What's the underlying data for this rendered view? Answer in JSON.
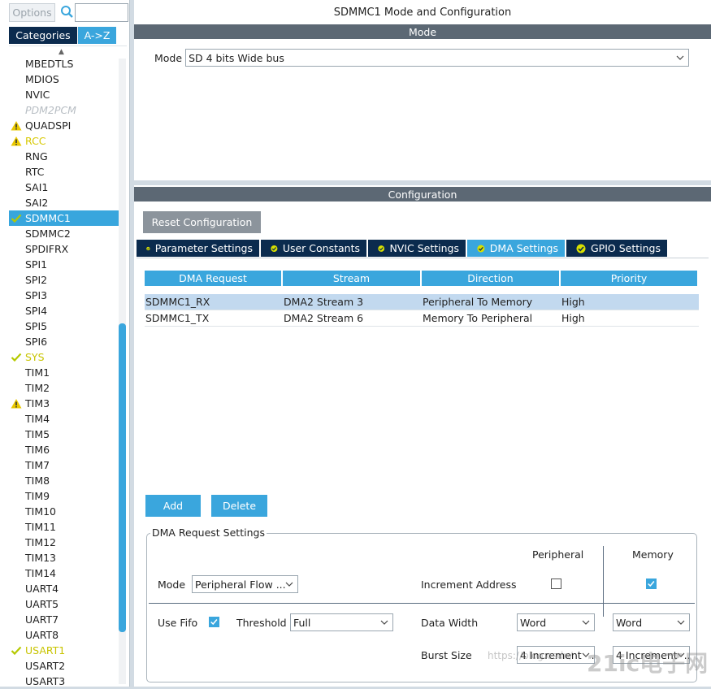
{
  "left": {
    "options_label": "Options",
    "search_placeholder": "",
    "tab_categories": "Categories",
    "tab_az": "A->Z",
    "items": [
      {
        "label": "MBEDTLS",
        "state": "normal"
      },
      {
        "label": "MDIOS",
        "state": "normal"
      },
      {
        "label": "NVIC",
        "state": "normal"
      },
      {
        "label": "PDM2PCM",
        "state": "disabled"
      },
      {
        "label": "QUADSPI",
        "state": "warning"
      },
      {
        "label": "RCC",
        "state": "warning-yellow"
      },
      {
        "label": "RNG",
        "state": "normal"
      },
      {
        "label": "RTC",
        "state": "normal"
      },
      {
        "label": "SAI1",
        "state": "normal"
      },
      {
        "label": "SAI2",
        "state": "normal"
      },
      {
        "label": "SDMMC1",
        "state": "selected-ok"
      },
      {
        "label": "SDMMC2",
        "state": "normal"
      },
      {
        "label": "SPDIFRX",
        "state": "normal"
      },
      {
        "label": "SPI1",
        "state": "normal"
      },
      {
        "label": "SPI2",
        "state": "normal"
      },
      {
        "label": "SPI3",
        "state": "normal"
      },
      {
        "label": "SPI4",
        "state": "normal"
      },
      {
        "label": "SPI5",
        "state": "normal"
      },
      {
        "label": "SPI6",
        "state": "normal"
      },
      {
        "label": "SYS",
        "state": "ok-yellow"
      },
      {
        "label": "TIM1",
        "state": "normal"
      },
      {
        "label": "TIM2",
        "state": "normal"
      },
      {
        "label": "TIM3",
        "state": "warning"
      },
      {
        "label": "TIM4",
        "state": "normal"
      },
      {
        "label": "TIM5",
        "state": "normal"
      },
      {
        "label": "TIM6",
        "state": "normal"
      },
      {
        "label": "TIM7",
        "state": "normal"
      },
      {
        "label": "TIM8",
        "state": "normal"
      },
      {
        "label": "TIM9",
        "state": "normal"
      },
      {
        "label": "TIM10",
        "state": "normal"
      },
      {
        "label": "TIM11",
        "state": "normal"
      },
      {
        "label": "TIM12",
        "state": "normal"
      },
      {
        "label": "TIM13",
        "state": "normal"
      },
      {
        "label": "TIM14",
        "state": "normal"
      },
      {
        "label": "UART4",
        "state": "normal"
      },
      {
        "label": "UART5",
        "state": "normal"
      },
      {
        "label": "UART7",
        "state": "normal"
      },
      {
        "label": "UART8",
        "state": "normal"
      },
      {
        "label": "USART1",
        "state": "ok-yellow"
      },
      {
        "label": "USART2",
        "state": "normal"
      },
      {
        "label": "USART3",
        "state": "normal"
      }
    ]
  },
  "mode_panel": {
    "title": "SDMMC1 Mode and Configuration",
    "section": "Mode",
    "mode_label": "Mode",
    "mode_value": "SD 4 bits Wide bus"
  },
  "config_panel": {
    "section": "Configuration",
    "reset_label": "Reset Configuration",
    "tabs": [
      {
        "label": "Parameter Settings",
        "active": false
      },
      {
        "label": "User Constants",
        "active": false
      },
      {
        "label": "NVIC Settings",
        "active": false
      },
      {
        "label": "DMA Settings",
        "active": true
      },
      {
        "label": "GPIO Settings",
        "active": false
      }
    ],
    "table": {
      "headers": [
        "DMA Request",
        "Stream",
        "Direction",
        "Priority"
      ],
      "rows": [
        [
          "SDMMC1_RX",
          "DMA2 Stream 3",
          "Peripheral To Memory",
          "High"
        ],
        [
          "SDMMC1_TX",
          "DMA2 Stream 6",
          "Memory To Peripheral",
          "High"
        ]
      ]
    },
    "add_label": "Add",
    "delete_label": "Delete",
    "request_settings": {
      "legend": "DMA Request Settings",
      "col_peripheral": "Peripheral",
      "col_memory": "Memory",
      "mode_label": "Mode",
      "mode_value": "Peripheral Flow ...",
      "increment_label": "Increment Address",
      "increment_peripheral": false,
      "increment_memory": true,
      "use_fifo_label": "Use Fifo",
      "use_fifo": true,
      "threshold_label": "Threshold",
      "threshold_value": "Full",
      "data_width_label": "Data Width",
      "data_width_peripheral": "Word",
      "data_width_memory": "Word",
      "burst_label": "Burst Size",
      "burst_peripheral": "4 Increment ...",
      "burst_memory": "4 Increment ..."
    }
  },
  "watermark": {
    "url": "https://blog.csdn/",
    "logo": "21ic电子网"
  },
  "colors": {
    "accent": "#3aa6dd",
    "navy": "#0b2b4e",
    "bar_gray": "#5c6874",
    "warning": "#e9c800",
    "ok": "#b5c900"
  }
}
